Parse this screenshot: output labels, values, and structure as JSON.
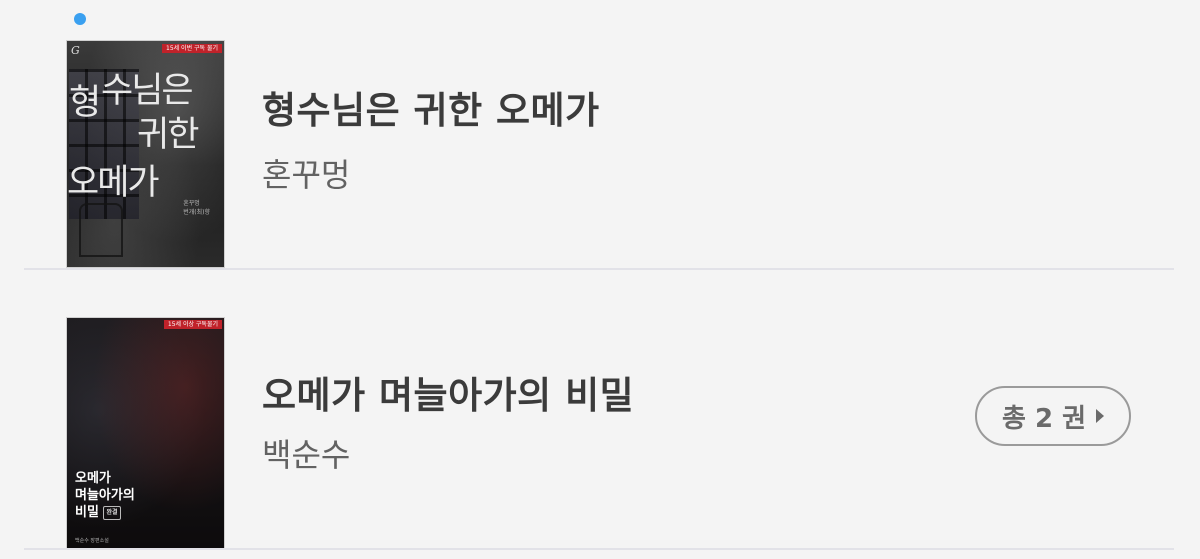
{
  "books": [
    {
      "title": "형수님은 귀한 오메가",
      "author": "혼꾸멍",
      "cover": {
        "logo": "G",
        "badge": "15세 이번 구독 물기",
        "title_parts": [
          "형",
          "수님은",
          "귀한",
          "오메가"
        ],
        "author_lines": [
          "혼꾸멍",
          "번개(최)향"
        ]
      }
    },
    {
      "title": "오메가 며늘아가의 비밀",
      "author": "백순수",
      "cover": {
        "badge": "15세 이상 구독물기",
        "title_lines": [
          "오메가",
          "며늘아가의",
          "비밀"
        ],
        "tag": "완결",
        "author": "백순수 장편소설"
      },
      "volume_label": "총 2 권"
    }
  ],
  "colors": {
    "accent_dot": "#3aa0f0",
    "badge_red": "#c0222a"
  }
}
